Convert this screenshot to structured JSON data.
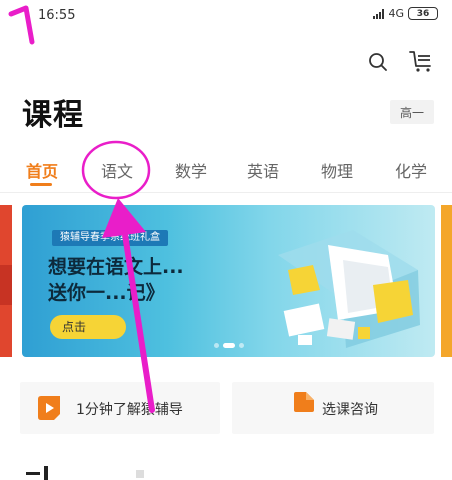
{
  "status_bar": {
    "time": "16:55",
    "network": "4G",
    "battery": "36"
  },
  "header": {
    "title": "课程",
    "grade": "高一"
  },
  "tabs": [
    {
      "label": "首页",
      "active": true
    },
    {
      "label": "语文",
      "active": false
    },
    {
      "label": "数学",
      "active": false
    },
    {
      "label": "英语",
      "active": false
    },
    {
      "label": "物理",
      "active": false
    },
    {
      "label": "化学",
      "active": false
    }
  ],
  "banner": {
    "tag": "猿辅导春季系统班礼盒",
    "line1": "想要在语文上...",
    "line2": "送你一...记》",
    "button": "点击"
  },
  "actions": [
    {
      "label": "1分钟了解猿辅导",
      "icon": "play-icon"
    },
    {
      "label": "选课咨询",
      "icon": "document-icon"
    }
  ],
  "annotation": {
    "step": "1",
    "color": "#e91ec9"
  },
  "colors": {
    "accent": "#f07e1b",
    "banner": "#4ec0df",
    "annotation": "#e91ec9"
  }
}
